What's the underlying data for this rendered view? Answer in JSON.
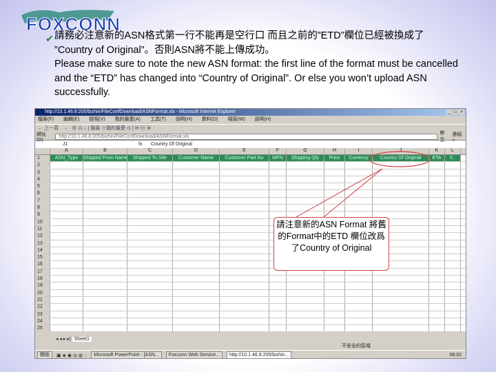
{
  "logo": {
    "text": "FOXCONN"
  },
  "intro": {
    "zh_line1": "請務必注意新的ASN格式第一行不能再是空行口 而且之前的”ETD”欄位已經被換成了",
    "zh_line2": "”Country of Original”。否則ASN將不能上傳成功。",
    "en": "Please make sure to note the new ASN format: the first line of the format must be cancelled and the “ETD” has changed into “Country of Original”. Or else you won’t upload ASN successfully."
  },
  "window": {
    "title": "http://10.1.46.8:205/bizhin/FileConfDownload/ASNFormat.xls - Microsoft Internet Explorer",
    "menu": [
      "檔案(F)",
      "編輯(E)",
      "檢視(V)",
      "我的最愛(A)",
      "工具(T)",
      "說明(H)",
      "資料(D)",
      "視窗(W)",
      "說明(H)"
    ],
    "toolbar": "← 上一頁 · → · ⊗ ⊡ ⌂ | 搜尋 ☆我的最愛 ◷ | ✉ ▤ ▣",
    "address_label": "網址(D)",
    "address": "http://10.1.46.8:205/bizhin/FileConfDownload/ASNFormat.xls",
    "go": "移至",
    "links": "連結 »",
    "cell_ref": "J1",
    "fx": "fx",
    "formula": "Country Of Original"
  },
  "sheet": {
    "columns": [
      "A",
      "B",
      "C",
      "D",
      "E",
      "F",
      "G",
      "H",
      "I",
      "J",
      "K",
      "L"
    ],
    "header_row": [
      "ASN_Type",
      "Shipped From Name",
      "Shipped To Site",
      "Customer Name",
      "Customer Part No",
      "MPN",
      "Shipping Qty",
      "Price",
      "Currency",
      "Country Of Original",
      "ETA",
      "II.."
    ],
    "row_numbers": [
      "1",
      "2",
      "3",
      "4",
      "5",
      "6",
      "7",
      "8",
      "9",
      "10",
      "11",
      "12",
      "13",
      "14",
      "15",
      "16",
      "17",
      "18",
      "19",
      "20",
      "21",
      "22",
      "23",
      "24",
      "25"
    ],
    "tab": "Sheet1",
    "status_right": "不安全的區域"
  },
  "taskbar": {
    "start": "開始",
    "items": [
      "Microsoft PowerPoint - [ASN...",
      "Foxconn Web Service...",
      "http://10.1.46.8:205/bizhin..."
    ],
    "clock": "08:02"
  },
  "callout": {
    "text": "請注意新的ASN Format 將舊的Format中的ETD 欄位改爲了Country of Original"
  },
  "colors": {
    "header_fill": "#2e8b57",
    "callout_border": "#d04040",
    "title_blue": "#0a246a"
  }
}
